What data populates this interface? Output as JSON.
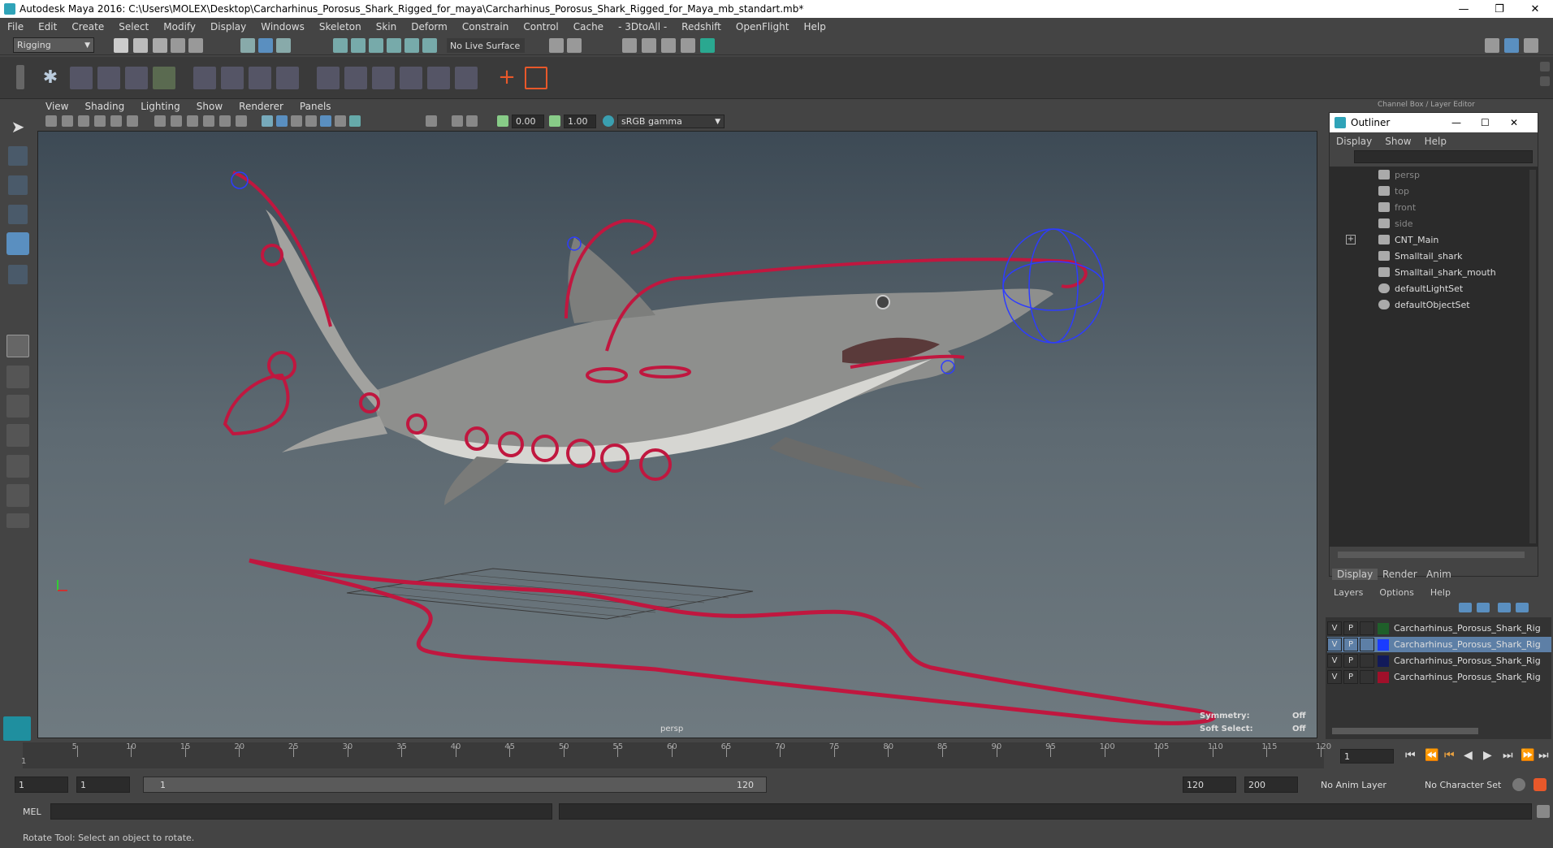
{
  "window": {
    "title": "Autodesk Maya 2016: C:\\Users\\MOLEX\\Desktop\\Carcharhinus_Porosus_Shark_Rigged_for_maya\\Carcharhinus_Porosus_Shark_Rigged_for_Maya_mb_standart.mb*"
  },
  "menu": [
    "File",
    "Edit",
    "Create",
    "Select",
    "Modify",
    "Display",
    "Windows",
    "Skeleton",
    "Skin",
    "Deform",
    "Constrain",
    "Control",
    "Cache",
    "- 3DtoAll -",
    "Redshift",
    "OpenFlight",
    "Help"
  ],
  "statusline": {
    "menuset": "Rigging",
    "live_surface": "No Live Surface"
  },
  "panel_menu": [
    "View",
    "Shading",
    "Lighting",
    "Show",
    "Renderer",
    "Panels"
  ],
  "panel_tools": {
    "near_value": "0.00",
    "far_value": "1.00",
    "color_space": "sRGB gamma"
  },
  "viewport": {
    "camera": "persp",
    "symmetry_label": "Symmetry:",
    "symmetry_value": "Off",
    "soft_select_label": "Soft Select:",
    "soft_select_value": "Off"
  },
  "dock_title": "Channel Box / Layer Editor",
  "outliner": {
    "title": "Outliner",
    "menu": [
      "Display",
      "Show",
      "Help"
    ],
    "items": [
      {
        "label": "persp",
        "dim": true
      },
      {
        "label": "top",
        "dim": true
      },
      {
        "label": "front",
        "dim": true
      },
      {
        "label": "side",
        "dim": true
      },
      {
        "label": "CNT_Main",
        "dim": false
      },
      {
        "label": "Smalltail_shark",
        "dim": false
      },
      {
        "label": "Smalltail_shark_mouth",
        "dim": false
      },
      {
        "label": "defaultLightSet",
        "dim": false
      },
      {
        "label": "defaultObjectSet",
        "dim": false
      }
    ]
  },
  "layer_editor": {
    "tabs": [
      "Display",
      "Render",
      "Anim"
    ],
    "menu": [
      "Layers",
      "Options",
      "Help"
    ],
    "layers": [
      {
        "v": "V",
        "p": "P",
        "color": "#1f5f2a",
        "name": "Carcharhinus_Porosus_Shark_Rig",
        "selected": false
      },
      {
        "v": "V",
        "p": "P",
        "color": "#1a3cff",
        "name": "Carcharhinus_Porosus_Shark_Rig",
        "selected": true
      },
      {
        "v": "V",
        "p": "P",
        "color": "#121a5a",
        "name": "Carcharhinus_Porosus_Shark_Rig",
        "selected": false
      },
      {
        "v": "V",
        "p": "P",
        "color": "#a0102a",
        "name": "Carcharhinus_Porosus_Shark_Rig",
        "selected": false
      }
    ]
  },
  "timeline": {
    "ticks": [
      "5",
      "10",
      "15",
      "20",
      "25",
      "30",
      "35",
      "40",
      "45",
      "50",
      "55",
      "60",
      "65",
      "70",
      "75",
      "80",
      "85",
      "90",
      "95",
      "100",
      "105",
      "110",
      "115",
      "120"
    ],
    "start_tick": "1",
    "current_frame": "1"
  },
  "range": {
    "start": "1",
    "anim_start": "1",
    "slider_start": "1",
    "slider_end": "120",
    "end": "120",
    "anim_end": "200",
    "anim_layer": "No Anim Layer",
    "char_set": "No Character Set"
  },
  "command": {
    "label": "MEL"
  },
  "help": {
    "text": "Rotate Tool: Select an object to rotate."
  }
}
